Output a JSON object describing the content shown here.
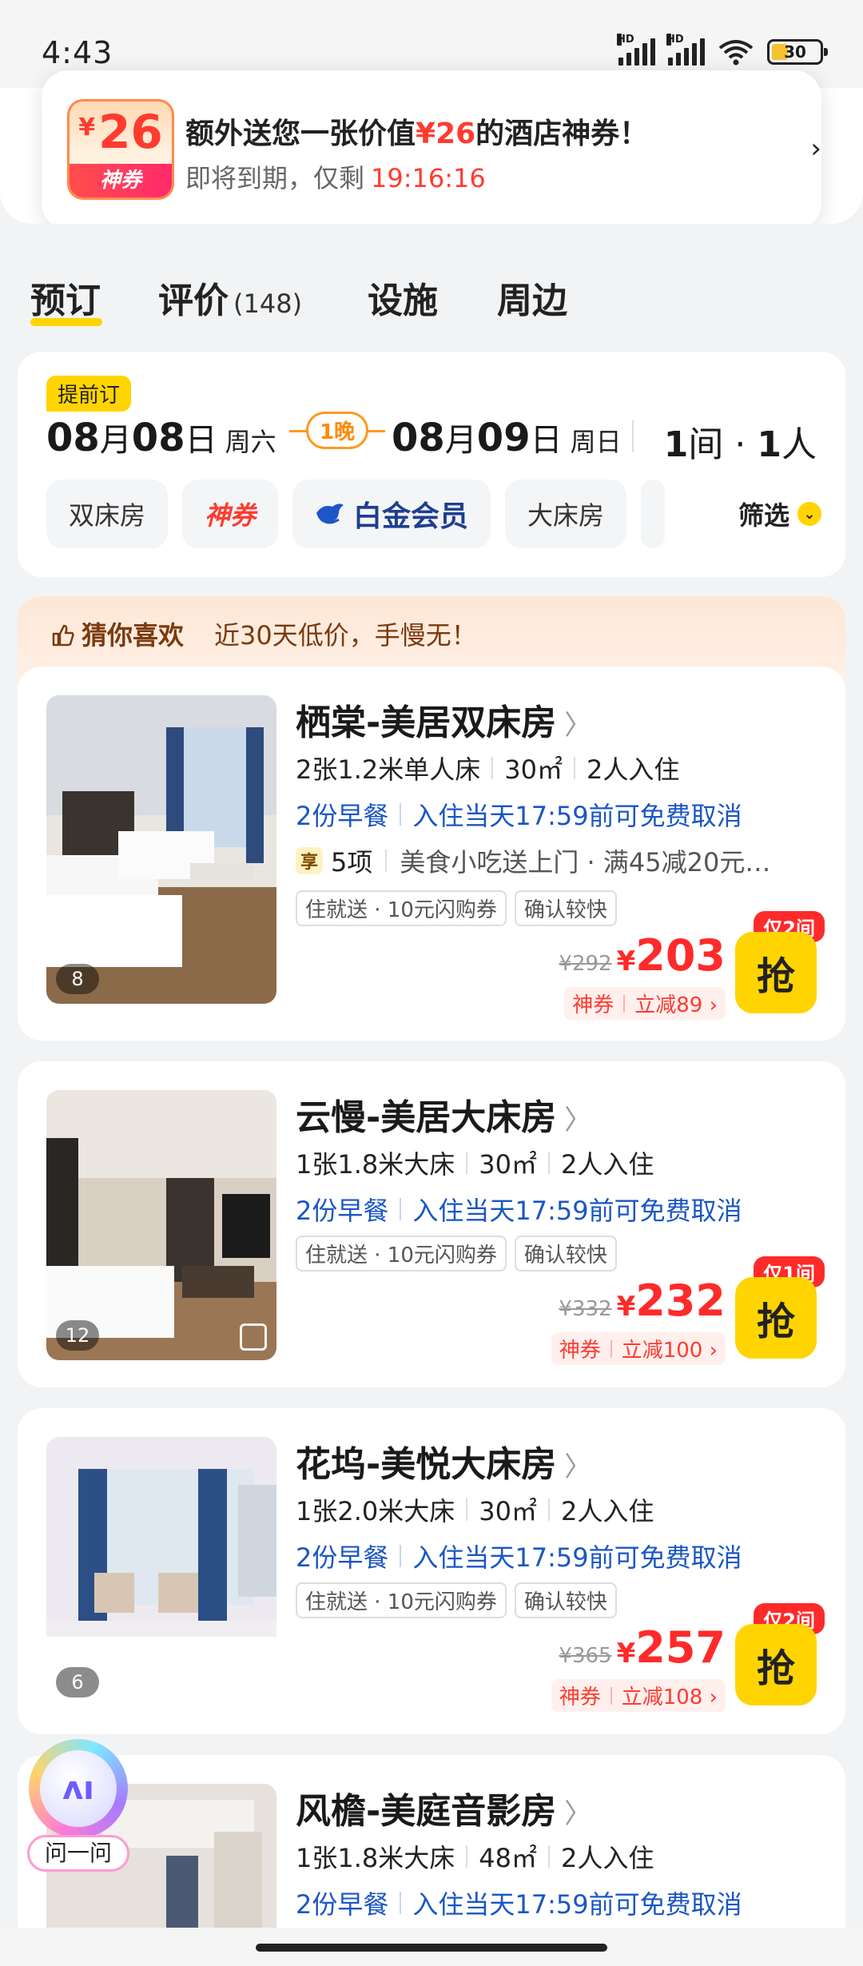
{
  "status_bar": {
    "time": "4:43",
    "battery": "30",
    "network_labels": [
      "HD",
      "HD"
    ],
    "wifi_label": "6"
  },
  "coupon_popup": {
    "badge_currency": "¥",
    "badge_amount": "26",
    "badge_label": "神券",
    "title_prefix": "额外送您一张价值",
    "title_amount": "¥26",
    "title_suffix": "的酒店神券！",
    "subtitle": "即将到期，仅剩",
    "countdown": "19:16:16",
    "arrow": "›"
  },
  "tabs": [
    {
      "label": "预订",
      "active": true
    },
    {
      "label": "评价",
      "count": "(148)"
    },
    {
      "label": "设施"
    },
    {
      "label": "周边"
    }
  ],
  "booking": {
    "early_tag": "提前订",
    "checkin": {
      "month": "08",
      "month_unit": "月",
      "day": "08",
      "day_unit": "日",
      "weekday": "周六"
    },
    "nights": "1晚",
    "checkout": {
      "month": "08",
      "month_unit": "月",
      "day": "09",
      "day_unit": "日",
      "weekday": "周日"
    },
    "rooms": "1",
    "rooms_unit": "间",
    "guests_sep": "·",
    "guests": "1",
    "guests_unit": "人",
    "chips": [
      "双床房",
      "神券",
      "白金会员",
      "大床房"
    ],
    "filter_label": "筛选"
  },
  "recommend": {
    "title": "猜你喜欢",
    "subtitle": "近30天低价，手慢无！"
  },
  "rooms": [
    {
      "name": "栖棠-美居双床房",
      "beds": "2张1.2米单人床",
      "area": "30㎡",
      "occupancy": "2人入住",
      "breakfast": "2份早餐",
      "cancel": "入住当天17:59前可免费取消",
      "perk_icon": "享",
      "perk_count": "5项",
      "perk_text": "美食小吃送上门 · 满45减20元…",
      "tags": [
        "住就送 · 10元闪购券",
        "确认较快"
      ],
      "image_count": "8",
      "original_price": "¥292",
      "currency": "¥",
      "price": "203",
      "discount_type": "神券",
      "discount": "立减89 ›",
      "availability": "仅2间",
      "book_label": "抢"
    },
    {
      "name": "云慢-美居大床房",
      "beds": "1张1.8米大床",
      "area": "30㎡",
      "occupancy": "2人入住",
      "breakfast": "2份早餐",
      "cancel": "入住当天17:59前可免费取消",
      "tags": [
        "住就送 · 10元闪购券",
        "确认较快"
      ],
      "image_count": "12",
      "original_price": "¥332",
      "currency": "¥",
      "price": "232",
      "discount_type": "神券",
      "discount": "立减100 ›",
      "availability": "仅1间",
      "book_label": "抢"
    },
    {
      "name": "花坞-美悦大床房",
      "beds": "1张2.0米大床",
      "area": "30㎡",
      "occupancy": "2人入住",
      "breakfast": "2份早餐",
      "cancel": "入住当天17:59前可免费取消",
      "tags": [
        "住就送 · 10元闪购券",
        "确认较快"
      ],
      "image_count": "6",
      "original_price": "¥365",
      "currency": "¥",
      "price": "257",
      "discount_type": "神券",
      "discount": "立减108 ›",
      "availability": "仅2间",
      "book_label": "抢"
    },
    {
      "name": "风檐-美庭音影房",
      "beds": "1张1.8米大床",
      "area": "48㎡",
      "occupancy": "2人入住",
      "breakfast": "2份早餐",
      "cancel": "入住当天17:59前可免费取消"
    }
  ],
  "assistant": {
    "label": "问一问",
    "glyph": "ʌı"
  },
  "colors": {
    "accent_yellow": "#ffd400",
    "price_red": "#ff2a2a",
    "policy_blue": "#1a56c4",
    "nights_orange": "#ff9a1f"
  },
  "icons": {
    "thumbs_up": "thumbs-up-icon",
    "vip": "vip-bird-icon",
    "filter_chevron": "chevron-down-icon",
    "chevron": "chevron-right-icon"
  }
}
